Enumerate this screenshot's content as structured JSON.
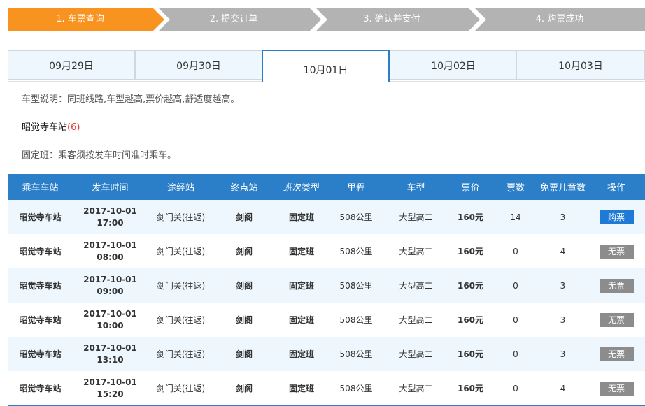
{
  "steps": [
    "1. 车票查询",
    "2. 提交订单",
    "3. 确认并支付",
    "4. 购票成功"
  ],
  "dates": [
    "09月29日",
    "09月30日",
    "10月01日",
    "10月02日",
    "10月03日"
  ],
  "active_date_index": 2,
  "info": {
    "vehicle_note": "车型说明：同班线路,车型越高,票价越高,舒适度越高。",
    "station_name": "昭觉寺车站",
    "station_count": "(6)",
    "fixed_note": "固定班：乘客须按发车时间准时乘车。"
  },
  "colors": {
    "accent": "#2b7fc9",
    "step_active": "#f7931e",
    "step_inactive": "#b3b3b3",
    "buy": "#1f7ad6",
    "no_ticket": "#8c8c8c",
    "count": "#e53935"
  },
  "table": {
    "headers": [
      "乘车车站",
      "发车时间",
      "途经站",
      "终点站",
      "班次类型",
      "里程",
      "车型",
      "票价",
      "票数",
      "免票儿童数",
      "操作"
    ],
    "rows": [
      {
        "station": "昭觉寺车站",
        "date": "2017-10-01",
        "time": "17:00",
        "via": "剑门关(往返)",
        "dest": "剑阁",
        "type": "固定班",
        "distance": "508公里",
        "vehicle": "大型高二",
        "price": "160元",
        "tickets": "14",
        "free_children": "3",
        "action": "购票"
      },
      {
        "station": "昭觉寺车站",
        "date": "2017-10-01",
        "time": "08:00",
        "via": "剑门关(往返)",
        "dest": "剑阁",
        "type": "固定班",
        "distance": "508公里",
        "vehicle": "大型高二",
        "price": "160元",
        "tickets": "0",
        "free_children": "4",
        "action": "无票"
      },
      {
        "station": "昭觉寺车站",
        "date": "2017-10-01",
        "time": "09:00",
        "via": "剑门关(往返)",
        "dest": "剑阁",
        "type": "固定班",
        "distance": "508公里",
        "vehicle": "大型高二",
        "price": "160元",
        "tickets": "0",
        "free_children": "3",
        "action": "无票"
      },
      {
        "station": "昭觉寺车站",
        "date": "2017-10-01",
        "time": "10:00",
        "via": "剑门关(往返)",
        "dest": "剑阁",
        "type": "固定班",
        "distance": "508公里",
        "vehicle": "大型高二",
        "price": "160元",
        "tickets": "0",
        "free_children": "3",
        "action": "无票"
      },
      {
        "station": "昭觉寺车站",
        "date": "2017-10-01",
        "time": "13:10",
        "via": "剑门关(往返)",
        "dest": "剑阁",
        "type": "固定班",
        "distance": "508公里",
        "vehicle": "大型高二",
        "price": "160元",
        "tickets": "0",
        "free_children": "3",
        "action": "无票"
      },
      {
        "station": "昭觉寺车站",
        "date": "2017-10-01",
        "time": "15:20",
        "via": "剑门关(往返)",
        "dest": "剑阁",
        "type": "固定班",
        "distance": "508公里",
        "vehicle": "大型高二",
        "price": "160元",
        "tickets": "0",
        "free_children": "4",
        "action": "无票"
      }
    ]
  }
}
